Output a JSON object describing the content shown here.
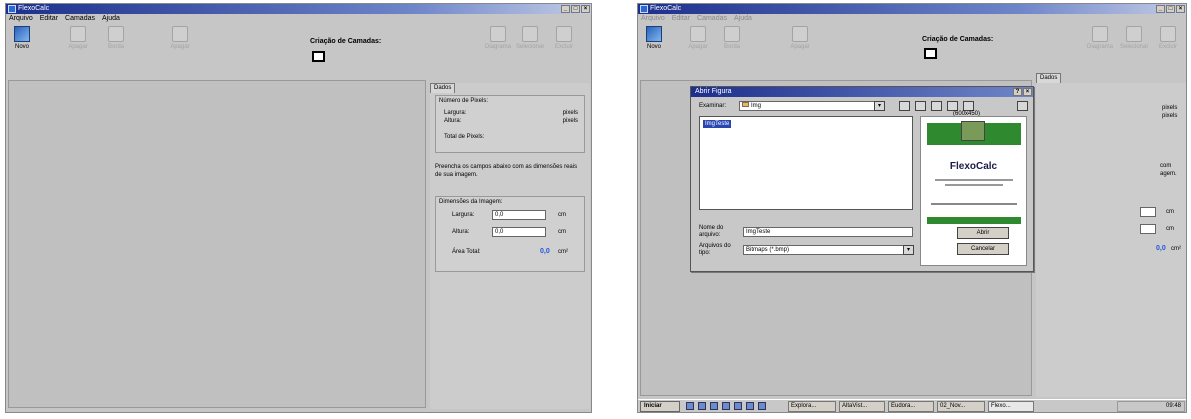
{
  "app": {
    "title": "FlexoCalc"
  },
  "menu": [
    "Arquivo",
    "Editar",
    "Camadas",
    "Ajuda"
  ],
  "toolbar": {
    "new_label": "Novo",
    "disabled_buttons": [
      "Apagar",
      "Borda",
      "Apagar"
    ],
    "layers_title": "Criação de Camadas:",
    "right_disabled": [
      "Diagrama",
      "Selecionar",
      "Excluir"
    ]
  },
  "panel": {
    "tab": "Dados",
    "pixel_group_title": "Número de Pixels:",
    "width_label": "Largura:",
    "height_label": "Altura:",
    "unit_pixels": "pixels",
    "total_pixels_label": "Total de Pixels:",
    "instructions": "Preencha os campos abaixo com as dimensões reais de sua imagem.",
    "dims_group_title": "Dimensões da Imagem:",
    "width_value": "0,0",
    "height_value": "0,0",
    "unit_cm": "cm",
    "area_label": "Área Total:",
    "area_value": "0,0",
    "area_unit": "cm²"
  },
  "panel2": {
    "tab": "Dados",
    "cut_pixels1": "pixels",
    "cut_pixels2": "pixels",
    "cut_text1": "com",
    "cut_text2": "agem.",
    "cut_cm1": "cm",
    "cut_cm2": "cm",
    "area_value": "0,0",
    "area_unit": "cm²"
  },
  "dialog": {
    "title": "Abrir Figura",
    "lookin_label": "Examinar:",
    "lookin_value": "Img",
    "preview_size": "(600x450)",
    "file_item": "ImgTeste",
    "filename_label": "Nome do arquivo:",
    "filename_value": "ImgTeste",
    "filetype_label": "Arquivos do tipo:",
    "filetype_value": "Bitmaps (*.bmp)",
    "open_button": "Abrir",
    "cancel_button": "Cancelar",
    "preview_brand": "FlexoCalc"
  },
  "taskbar": {
    "start": "Iniciar",
    "tasks": [
      "Explora...",
      "AltaVist...",
      "Eudora...",
      "02_Nov...",
      "Flexo..."
    ],
    "clock": "09:48"
  }
}
